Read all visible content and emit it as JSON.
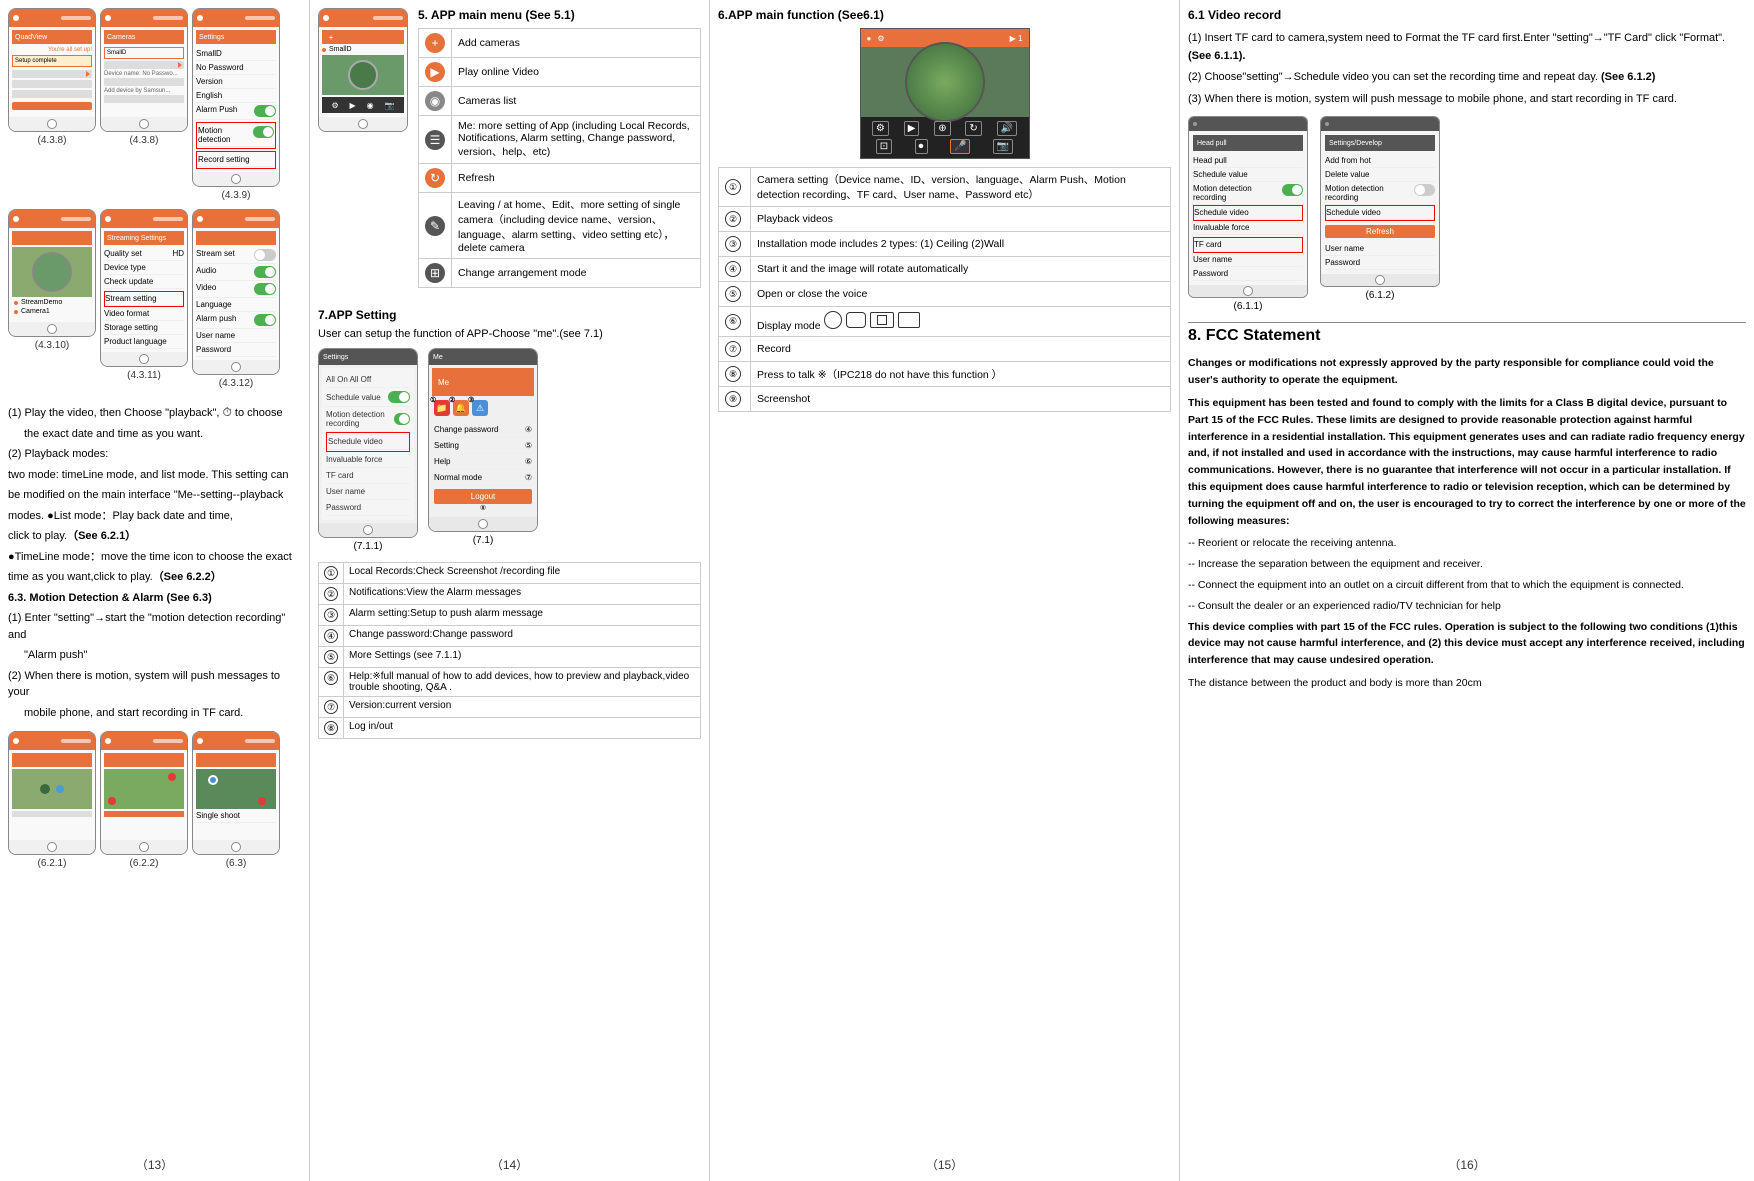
{
  "page": {
    "columns": [
      {
        "id": "col1",
        "page_number": "（13）",
        "phone_rows": [
          {
            "phones": [
              {
                "label": "(4.3.8)",
                "type": "list"
              },
              {
                "label": "(4.3.8)",
                "type": "list2"
              },
              {
                "label": "(4.3.9)",
                "type": "form"
              }
            ]
          },
          {
            "phones": [
              {
                "label": "(4.3.10)",
                "type": "map"
              },
              {
                "label": "(4.3.11)",
                "type": "settings"
              },
              {
                "label": "(4.3.12)",
                "type": "settings2"
              }
            ]
          }
        ],
        "text_block": {
          "items": [
            "(1) Play the video, then Choose \"playback\", to choose",
            "    the exact date and time as you want.",
            "(2) Playback modes:",
            "two mode: timeLine mode, and list mode. This setting can",
            "be modified on the main interface \"Me--setting--playback",
            "modes.     ●List mode：Play back date and time,",
            "click to play.（See 6.2.1）",
            "●TimeLine mode： move the time icon to choose the exact",
            "time as you want,click to play.（See 6.2.2）",
            "6.3. Motion Detection & Alarm (See 6.3)",
            "(1) Enter \"setting\"→start the \"motion detection recording\" and",
            "    \"Alarm push\"",
            "(2) When there is motion, system will push messages to your",
            "    mobile phone, and start recording in TF card."
          ]
        },
        "bottom_phones": [
          {
            "label": "(6.2.1)",
            "type": "timeline"
          },
          {
            "label": "(6.2.2)",
            "type": "timeline2"
          },
          {
            "label": "(6.3)",
            "type": "motion"
          }
        ]
      },
      {
        "id": "col2",
        "page_number": "（14）",
        "section1_title": "5. APP main menu (See 5.1)",
        "menu_items": [
          {
            "icon": "+",
            "icon_style": "orange",
            "text": "Add cameras"
          },
          {
            "icon": "▶",
            "icon_style": "orange",
            "text": "Play online Video"
          },
          {
            "icon": "●",
            "icon_style": "gray",
            "text": "Cameras list"
          },
          {
            "icon": "☰",
            "icon_style": "dark",
            "text": "Me: more setting of App (including Local Records, Notifications, Alarm setting, Change password, version、help、etc)"
          },
          {
            "icon": "↻",
            "icon_style": "orange",
            "text": "Refresh"
          },
          {
            "icon": "⊞",
            "icon_style": "dark",
            "text": "Leaving / at home、Edit、more setting of single camera（including device name、version、language、alarm setting、video setting  etc），delete camera"
          },
          {
            "icon": "⊞",
            "icon_style": "dark",
            "text": "Change arrangement mode"
          }
        ],
        "section2_title": "7.APP Setting",
        "section2_sub": "User can setup the function of APP-Choose \"me\".(see 7.1)",
        "phone_711_label": "(7.1.1)",
        "phone_71_label": "(7.1)",
        "items_711": [
          {
            "num": "①",
            "text": "Local Records:Check Screenshot /recording file"
          },
          {
            "num": "②",
            "text": "Notifications:View the Alarm messages"
          },
          {
            "num": "③",
            "text": "Alarm setting:Setup to push alarm message"
          },
          {
            "num": "④",
            "text": "Change password:Change password"
          },
          {
            "num": "⑤",
            "text": "More Settings (see 7.1.1)"
          },
          {
            "num": "⑥",
            "text": "Help:※full manual of how to add devices, how to preview and playback,video trouble shooting, Q&A ."
          },
          {
            "num": "⑦",
            "text": "Version:current version"
          },
          {
            "num": "⑧",
            "text": "Log in/out"
          }
        ]
      },
      {
        "id": "col3",
        "page_number": "（15）",
        "section_title": "6.APP main function (See6.1)",
        "func_items": [
          {
            "num": "①",
            "text": "Camera setting（Device name、ID、version、language、Alarm Push、Motion detection recording、TF card、User name、Password etc）"
          },
          {
            "num": "②",
            "text": "Playback videos"
          },
          {
            "num": "③",
            "text": "Installation mode includes 2 types: (1) Ceiling   (2)Wall"
          },
          {
            "num": "④",
            "text": "Start  it and the image will rotate automatically"
          },
          {
            "num": "⑤",
            "text": "Open or close the voice"
          },
          {
            "num": "⑥",
            "text": "Display mode"
          },
          {
            "num": "⑦",
            "text": "Record"
          },
          {
            "num": "⑧",
            "text": "Press to talk ※（IPC218 do not have this function ）"
          },
          {
            "num": "⑨",
            "text": "Screenshot"
          }
        ]
      },
      {
        "id": "col4",
        "page_number": "（16）",
        "video_record_title": "6.1  Video record",
        "video_record_items": [
          "(1) Insert TF card to camera,system need to Format the TF card first.Enter \"setting\"→\"TF Card\" click \"Format\". (See 6.1.1).",
          "(2) Choose\"setting\"→Schedule video  you can set the recording time and repeat day. (See 6.1.2)",
          "(3) When there is motion, system will push message to mobile phone,  and start recording in TF card."
        ],
        "phone_611_label": "(6.1.1)",
        "phone_612_label": "(6.1.2)",
        "fcc_title": "8.  FCC Statement",
        "fcc_paragraphs": [
          "Changes or modifications not expressly approved by the party responsible for compliance could void the user's authority to operate the equipment.",
          "This equipment has been tested and found to comply with the limits for a Class B digital device, pursuant to Part 15 of the FCC Rules. These limits are designed to provide reasonable protection against harmful interference in a residential installation. This equipment generates uses and can radiate radio frequency energy and, if not installed and used in accordance with the instructions, may cause harmful interference to radio communications. However, there is no guarantee that interference will not occur in a particular installation. If this equipment does cause harmful interference to radio or television reception, which can be determined by turning the equipment off and on, the user is encouraged to try to correct the interference by one or more of the following measures:"
        ],
        "fcc_dashes": [
          "-- Reorient or relocate the receiving antenna.",
          "-- Increase the separation between the equipment and receiver.",
          "-- Connect the equipment into an outlet on a circuit different from that to which the equipment is connected.",
          "-- Consult the dealer or an experienced radio/TV technician for help"
        ],
        "fcc_final": [
          "This device complies with part 15 of the FCC rules. Operation is subject to the following two conditions (1)this device may not cause harmful interference, and (2) this device must accept any interference received, including interference that may cause undesired operation.",
          "The distance between the product and body is more than 20cm"
        ]
      }
    ]
  }
}
